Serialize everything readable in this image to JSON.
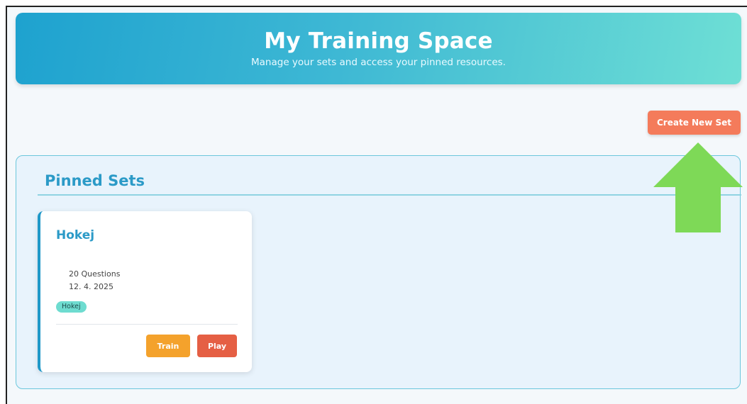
{
  "header": {
    "title": "My Training Space",
    "subtitle": "Manage your sets and access your pinned resources."
  },
  "toolbar": {
    "create_label": "Create New Set"
  },
  "pinned": {
    "title": "Pinned Sets",
    "cards": [
      {
        "title": "Hokej",
        "questions": "20 Questions",
        "date": "12. 4. 2025",
        "tag": "Hokej",
        "train_label": "Train",
        "play_label": "Play"
      }
    ]
  },
  "annotation": {
    "arrow_icon": "arrow-up-icon",
    "arrow_color": "#7ed957"
  },
  "colors": {
    "header_gradient_start": "#1ea2cf",
    "header_gradient_end": "#6edfd5",
    "create_button": "#f47b5b",
    "train_button": "#f4a22c",
    "play_button": "#e55f44",
    "accent_text": "#2b9ac7",
    "tag_bg": "#6edcd0"
  }
}
